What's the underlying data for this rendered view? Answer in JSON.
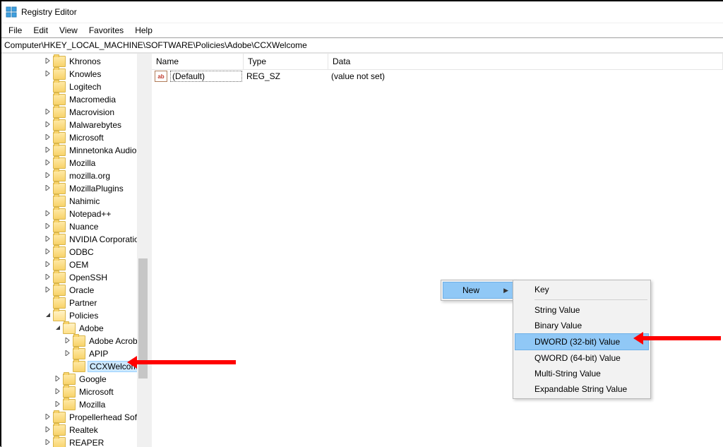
{
  "window": {
    "title": "Registry Editor"
  },
  "menubar": [
    "File",
    "Edit",
    "View",
    "Favorites",
    "Help"
  ],
  "address": "Computer\\HKEY_LOCAL_MACHINE\\SOFTWARE\\Policies\\Adobe\\CCXWelcome",
  "tree": [
    {
      "d": 4,
      "tw": ">",
      "label": "Khronos"
    },
    {
      "d": 4,
      "tw": ">",
      "label": "Knowles"
    },
    {
      "d": 4,
      "tw": "",
      "label": "Logitech"
    },
    {
      "d": 4,
      "tw": "",
      "label": "Macromedia"
    },
    {
      "d": 4,
      "tw": ">",
      "label": "Macrovision"
    },
    {
      "d": 4,
      "tw": ">",
      "label": "Malwarebytes"
    },
    {
      "d": 4,
      "tw": ">",
      "label": "Microsoft"
    },
    {
      "d": 4,
      "tw": ">",
      "label": "Minnetonka Audio Software"
    },
    {
      "d": 4,
      "tw": ">",
      "label": "Mozilla"
    },
    {
      "d": 4,
      "tw": ">",
      "label": "mozilla.org"
    },
    {
      "d": 4,
      "tw": ">",
      "label": "MozillaPlugins"
    },
    {
      "d": 4,
      "tw": "",
      "label": "Nahimic"
    },
    {
      "d": 4,
      "tw": ">",
      "label": "Notepad++"
    },
    {
      "d": 4,
      "tw": ">",
      "label": "Nuance"
    },
    {
      "d": 4,
      "tw": ">",
      "label": "NVIDIA Corporation"
    },
    {
      "d": 4,
      "tw": ">",
      "label": "ODBC"
    },
    {
      "d": 4,
      "tw": ">",
      "label": "OEM"
    },
    {
      "d": 4,
      "tw": ">",
      "label": "OpenSSH"
    },
    {
      "d": 4,
      "tw": ">",
      "label": "Oracle"
    },
    {
      "d": 4,
      "tw": "",
      "label": "Partner"
    },
    {
      "d": 4,
      "tw": "v",
      "label": "Policies",
      "open": true
    },
    {
      "d": 5,
      "tw": "v",
      "label": "Adobe",
      "open": true
    },
    {
      "d": 6,
      "tw": ">",
      "label": "Adobe Acrobat"
    },
    {
      "d": 6,
      "tw": ">",
      "label": "APIP"
    },
    {
      "d": 6,
      "tw": "",
      "label": "CCXWelcome",
      "selected": true
    },
    {
      "d": 5,
      "tw": ">",
      "label": "Google"
    },
    {
      "d": 5,
      "tw": ">",
      "label": "Microsoft"
    },
    {
      "d": 5,
      "tw": ">",
      "label": "Mozilla"
    },
    {
      "d": 4,
      "tw": ">",
      "label": "Propellerhead Software"
    },
    {
      "d": 4,
      "tw": ">",
      "label": "Realtek"
    },
    {
      "d": 4,
      "tw": ">",
      "label": "REAPER"
    }
  ],
  "list": {
    "columns": [
      "Name",
      "Type",
      "Data"
    ],
    "rows": [
      {
        "icon_text": "ab",
        "name": "(Default)",
        "type": "REG_SZ",
        "data": "(value not set)"
      }
    ]
  },
  "context_parent": {
    "label": "New"
  },
  "context_sub": [
    {
      "label": "Key"
    },
    {
      "sep": true
    },
    {
      "label": "String Value"
    },
    {
      "label": "Binary Value"
    },
    {
      "label": "DWORD (32-bit) Value",
      "hover": true
    },
    {
      "label": "QWORD (64-bit) Value"
    },
    {
      "label": "Multi-String Value"
    },
    {
      "label": "Expandable String Value"
    }
  ]
}
